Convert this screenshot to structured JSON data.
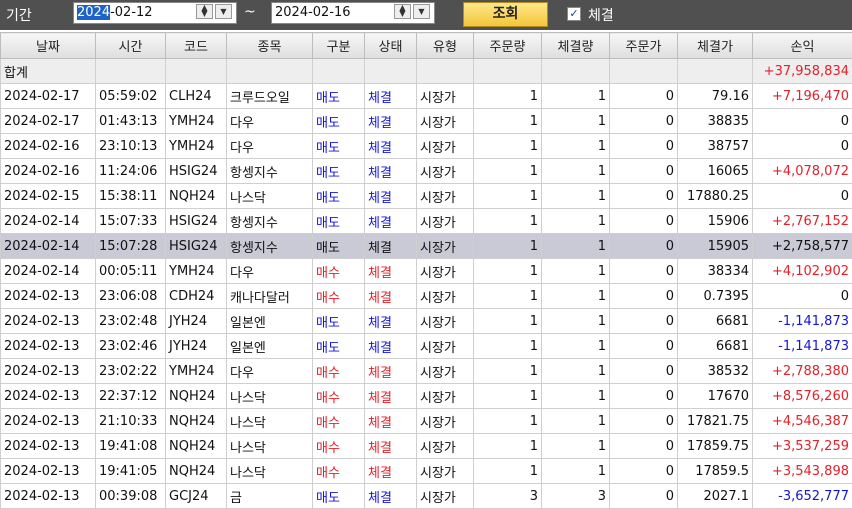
{
  "toolbar": {
    "period_label": "기간",
    "start_year": "2024",
    "start_rest": "-02-12",
    "tilde": "~",
    "end_date": "2024-02-16",
    "query_button": "조회",
    "checkbox_checked": true,
    "checkbox_label": "체결"
  },
  "columns": [
    "날짜",
    "시간",
    "코드",
    "종목",
    "구분",
    "상태",
    "유형",
    "주문량",
    "체결량",
    "주문가",
    "체결가",
    "손익"
  ],
  "total": {
    "label": "합계",
    "pnl": "+37,958,834"
  },
  "colors": {
    "sell": "#1515d8",
    "buy": "#e5202a",
    "profit": "#e5202a",
    "loss": "#1515d8",
    "selected_row": "#c9cad6"
  },
  "rows": [
    {
      "date": "2024-02-17",
      "time": "05:59:02",
      "code": "CLH24",
      "name": "크루드오일",
      "side": "매도",
      "status": "체결",
      "type": "시장가",
      "order_qty": "1",
      "fill_qty": "1",
      "order_price": "0",
      "fill_price": "79.16",
      "pnl": "+7,196,470"
    },
    {
      "date": "2024-02-17",
      "time": "01:43:13",
      "code": "YMH24",
      "name": "다우",
      "side": "매도",
      "status": "체결",
      "type": "시장가",
      "order_qty": "1",
      "fill_qty": "1",
      "order_price": "0",
      "fill_price": "38835",
      "pnl": "0"
    },
    {
      "date": "2024-02-16",
      "time": "23:10:13",
      "code": "YMH24",
      "name": "다우",
      "side": "매도",
      "status": "체결",
      "type": "시장가",
      "order_qty": "1",
      "fill_qty": "1",
      "order_price": "0",
      "fill_price": "38757",
      "pnl": "0"
    },
    {
      "date": "2024-02-16",
      "time": "11:24:06",
      "code": "HSIG24",
      "name": "항셍지수",
      "side": "매도",
      "status": "체결",
      "type": "시장가",
      "order_qty": "1",
      "fill_qty": "1",
      "order_price": "0",
      "fill_price": "16065",
      "pnl": "+4,078,072"
    },
    {
      "date": "2024-02-15",
      "time": "15:38:11",
      "code": "NQH24",
      "name": "나스닥",
      "side": "매도",
      "status": "체결",
      "type": "시장가",
      "order_qty": "1",
      "fill_qty": "1",
      "order_price": "0",
      "fill_price": "17880.25",
      "pnl": "0"
    },
    {
      "date": "2024-02-14",
      "time": "15:07:33",
      "code": "HSIG24",
      "name": "항셍지수",
      "side": "매도",
      "status": "체결",
      "type": "시장가",
      "order_qty": "1",
      "fill_qty": "1",
      "order_price": "0",
      "fill_price": "15906",
      "pnl": "+2,767,152"
    },
    {
      "date": "2024-02-14",
      "time": "15:07:28",
      "code": "HSIG24",
      "name": "항셍지수",
      "side": "매도",
      "status": "체결",
      "type": "시장가",
      "order_qty": "1",
      "fill_qty": "1",
      "order_price": "0",
      "fill_price": "15905",
      "pnl": "+2,758,577",
      "selected": true
    },
    {
      "date": "2024-02-14",
      "time": "00:05:11",
      "code": "YMH24",
      "name": "다우",
      "side": "매수",
      "status": "체결",
      "type": "시장가",
      "order_qty": "1",
      "fill_qty": "1",
      "order_price": "0",
      "fill_price": "38334",
      "pnl": "+4,102,902"
    },
    {
      "date": "2024-02-13",
      "time": "23:06:08",
      "code": "CDH24",
      "name": "캐나다달러",
      "side": "매수",
      "status": "체결",
      "type": "시장가",
      "order_qty": "1",
      "fill_qty": "1",
      "order_price": "0",
      "fill_price": "0.7395",
      "pnl": "0"
    },
    {
      "date": "2024-02-13",
      "time": "23:02:48",
      "code": "JYH24",
      "name": "일본엔",
      "side": "매도",
      "status": "체결",
      "type": "시장가",
      "order_qty": "1",
      "fill_qty": "1",
      "order_price": "0",
      "fill_price": "6681",
      "pnl": "-1,141,873"
    },
    {
      "date": "2024-02-13",
      "time": "23:02:46",
      "code": "JYH24",
      "name": "일본엔",
      "side": "매도",
      "status": "체결",
      "type": "시장가",
      "order_qty": "1",
      "fill_qty": "1",
      "order_price": "0",
      "fill_price": "6681",
      "pnl": "-1,141,873"
    },
    {
      "date": "2024-02-13",
      "time": "23:02:22",
      "code": "YMH24",
      "name": "다우",
      "side": "매수",
      "status": "체결",
      "type": "시장가",
      "order_qty": "1",
      "fill_qty": "1",
      "order_price": "0",
      "fill_price": "38532",
      "pnl": "+2,788,380"
    },
    {
      "date": "2024-02-13",
      "time": "22:37:12",
      "code": "NQH24",
      "name": "나스닥",
      "side": "매수",
      "status": "체결",
      "type": "시장가",
      "order_qty": "1",
      "fill_qty": "1",
      "order_price": "0",
      "fill_price": "17670",
      "pnl": "+8,576,260"
    },
    {
      "date": "2024-02-13",
      "time": "21:10:33",
      "code": "NQH24",
      "name": "나스닥",
      "side": "매수",
      "status": "체결",
      "type": "시장가",
      "order_qty": "1",
      "fill_qty": "1",
      "order_price": "0",
      "fill_price": "17821.75",
      "pnl": "+4,546,387"
    },
    {
      "date": "2024-02-13",
      "time": "19:41:08",
      "code": "NQH24",
      "name": "나스닥",
      "side": "매수",
      "status": "체결",
      "type": "시장가",
      "order_qty": "1",
      "fill_qty": "1",
      "order_price": "0",
      "fill_price": "17859.75",
      "pnl": "+3,537,259"
    },
    {
      "date": "2024-02-13",
      "time": "19:41:05",
      "code": "NQH24",
      "name": "나스닥",
      "side": "매수",
      "status": "체결",
      "type": "시장가",
      "order_qty": "1",
      "fill_qty": "1",
      "order_price": "0",
      "fill_price": "17859.5",
      "pnl": "+3,543,898"
    },
    {
      "date": "2024-02-13",
      "time": "00:39:08",
      "code": "GCJ24",
      "name": "금",
      "side": "매도",
      "status": "체결",
      "type": "시장가",
      "order_qty": "3",
      "fill_qty": "3",
      "order_price": "0",
      "fill_price": "2027.1",
      "pnl": "-3,652,777"
    }
  ]
}
